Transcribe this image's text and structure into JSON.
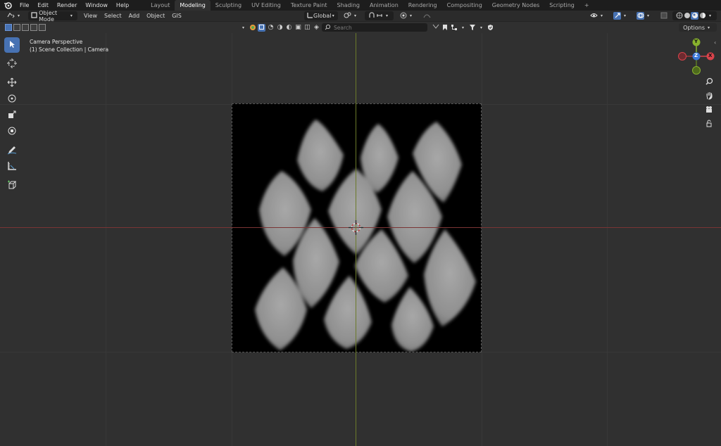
{
  "topbar": {
    "menu": [
      "File",
      "Edit",
      "Render",
      "Window",
      "Help"
    ],
    "tabs": [
      "Layout",
      "Modeling",
      "Sculpting",
      "UV Editing",
      "Texture Paint",
      "Shading",
      "Animation",
      "Rendering",
      "Compositing",
      "Geometry Nodes",
      "Scripting"
    ],
    "active_tab": "Modeling",
    "add_tab": "+"
  },
  "header": {
    "mode": "Object Mode",
    "menus": [
      "View",
      "Select",
      "Add",
      "Object",
      "GIS"
    ],
    "orientation": "Global"
  },
  "subbar": {
    "search_placeholder": "Search",
    "options_label": "Options"
  },
  "viewport": {
    "title": "Camera Perspective",
    "subtitle": "(1) Scene Collection | Camera"
  },
  "gizmo": {
    "x_label": "X",
    "y_label": "Y",
    "z_label": "Z"
  },
  "colors": {
    "accent": "#4772b3",
    "x_axis": "#d9434b",
    "y_axis": "#88b22d",
    "z_axis": "#3a78d8",
    "background": "#303030"
  }
}
